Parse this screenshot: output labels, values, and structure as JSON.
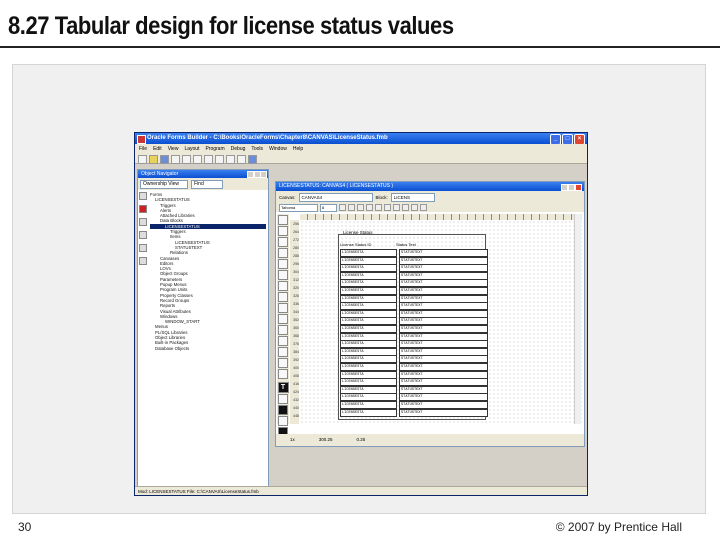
{
  "slide": {
    "title": "8.27 Tabular design for license status values",
    "page_number": "30",
    "copyright": "© 2007 by Prentice Hall"
  },
  "window": {
    "title": "Oracle Forms Builder - C:\\Books\\OracleForms\\Chapter8\\CANVAS\\LicenseStatus.fmb",
    "menu": [
      "File",
      "Edit",
      "View",
      "Layout",
      "Program",
      "Debug",
      "Tools",
      "Window",
      "Help"
    ],
    "status_bar": "Mod: LICENSESTATUS  File: C:\\CANVAS\\LicenseStatus.fmb"
  },
  "object_navigator": {
    "title": "Object Navigator",
    "scope_value": "Ownership View",
    "find_label": "Find",
    "tree": [
      {
        "label": "Forms",
        "indent": 0
      },
      {
        "label": "LICENSESTATUS",
        "indent": 1
      },
      {
        "label": "Triggers",
        "indent": 2
      },
      {
        "label": "Alerts",
        "indent": 2
      },
      {
        "label": "Attached Libraries",
        "indent": 2
      },
      {
        "label": "Data Blocks",
        "indent": 2
      },
      {
        "label": "LICENSESTATUS",
        "indent": 3,
        "selected": true
      },
      {
        "label": "Triggers",
        "indent": 4
      },
      {
        "label": "Items",
        "indent": 4
      },
      {
        "label": "LICENSESTATUS",
        "indent": 5
      },
      {
        "label": "STATUSTEXT",
        "indent": 5
      },
      {
        "label": "Relations",
        "indent": 4
      },
      {
        "label": "Canvases",
        "indent": 2
      },
      {
        "label": "Editors",
        "indent": 2
      },
      {
        "label": "LOVs",
        "indent": 2
      },
      {
        "label": "Object Groups",
        "indent": 2
      },
      {
        "label": "Parameters",
        "indent": 2
      },
      {
        "label": "Popup Menus",
        "indent": 2
      },
      {
        "label": "Program Units",
        "indent": 2
      },
      {
        "label": "Property Classes",
        "indent": 2
      },
      {
        "label": "Record Groups",
        "indent": 2
      },
      {
        "label": "Reports",
        "indent": 2
      },
      {
        "label": "Visual Attributes",
        "indent": 2
      },
      {
        "label": "Windows",
        "indent": 2
      },
      {
        "label": "WINDOW_START",
        "indent": 3
      },
      {
        "label": "Menus",
        "indent": 1
      },
      {
        "label": "PL/SQL Libraries",
        "indent": 1
      },
      {
        "label": "Object Libraries",
        "indent": 1
      },
      {
        "label": "Built-in Packages",
        "indent": 1
      },
      {
        "label": "Database Objects",
        "indent": 1
      }
    ]
  },
  "layout_editor": {
    "title": "LICENSESTATUS: CANVAS4 ( LICENSESTATUS )",
    "canvas_label": "Canvas:",
    "canvas_value": "CANVAS4",
    "block_label": "Block:",
    "block_value": "LICENS",
    "font_value": "Tahoma",
    "font_size": "8",
    "frame_title": "License Status",
    "column_headers": [
      "License Status ID",
      "Status Text"
    ],
    "id_field": "LICENSESTA",
    "desc_field": "STATUSTEXT",
    "ruler_marks": [
      "256",
      "264",
      "272",
      "280",
      "288",
      "296",
      "304",
      "312",
      "320",
      "328",
      "336",
      "344",
      "352",
      "360",
      "368",
      "376",
      "384",
      "392",
      "400",
      "408",
      "416",
      "424",
      "432",
      "440",
      "448"
    ],
    "status_zoom": "1x",
    "status_pos1": "300.25",
    "status_pos2": "0.25"
  },
  "colors": {
    "title_bar": "#0a4fd0",
    "selection": "#0a246a",
    "chrome": "#ece9d8"
  }
}
